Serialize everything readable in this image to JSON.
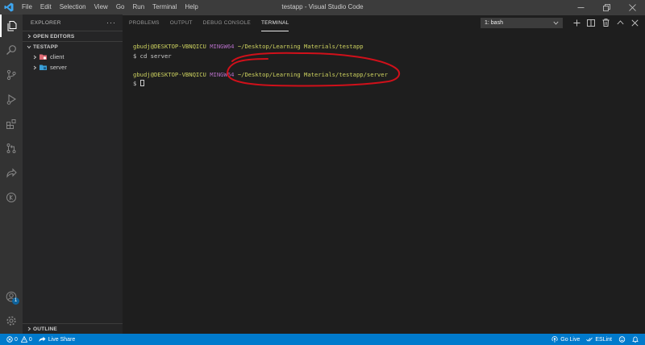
{
  "window": {
    "title": "testapp - Visual Studio Code",
    "menu": [
      "File",
      "Edit",
      "Selection",
      "View",
      "Go",
      "Run",
      "Terminal",
      "Help"
    ]
  },
  "sidebar": {
    "header": "EXPLORER",
    "open_editors": "OPEN EDITORS",
    "project": "TESTAPP",
    "folders": [
      "client",
      "server"
    ],
    "outline": "OUTLINE"
  },
  "panel": {
    "tabs": [
      "PROBLEMS",
      "OUTPUT",
      "DEBUG CONSOLE",
      "TERMINAL"
    ],
    "active_tab": "TERMINAL",
    "terminal_select": "1: bash"
  },
  "terminal": {
    "line1_user": "gbudj@DESKTOP-VBNQICU",
    "line1_host": "MINGW64",
    "line1_path": "~/Desktop/Learning Materials/testapp",
    "line2": "$ cd server",
    "line3_user": "gbudj@DESKTOP-VBNQICU",
    "line3_host": "MINGW64",
    "line3_path": "~/Desktop/Learning Materials/testapp/server",
    "line4": "$ "
  },
  "accounts_badge": "1",
  "statusbar": {
    "errors": "0",
    "warnings": "0",
    "live_share": "Live Share",
    "go_live": "Go Live",
    "eslint": "ESLint"
  },
  "colors": {
    "accent": "#007acc",
    "annotation": "#d0101a",
    "prompt_yellow": "#cdd25f",
    "prompt_purple": "#b36ec4",
    "client_folder": "#e06c75",
    "server_folder": "#3aa0d8"
  }
}
